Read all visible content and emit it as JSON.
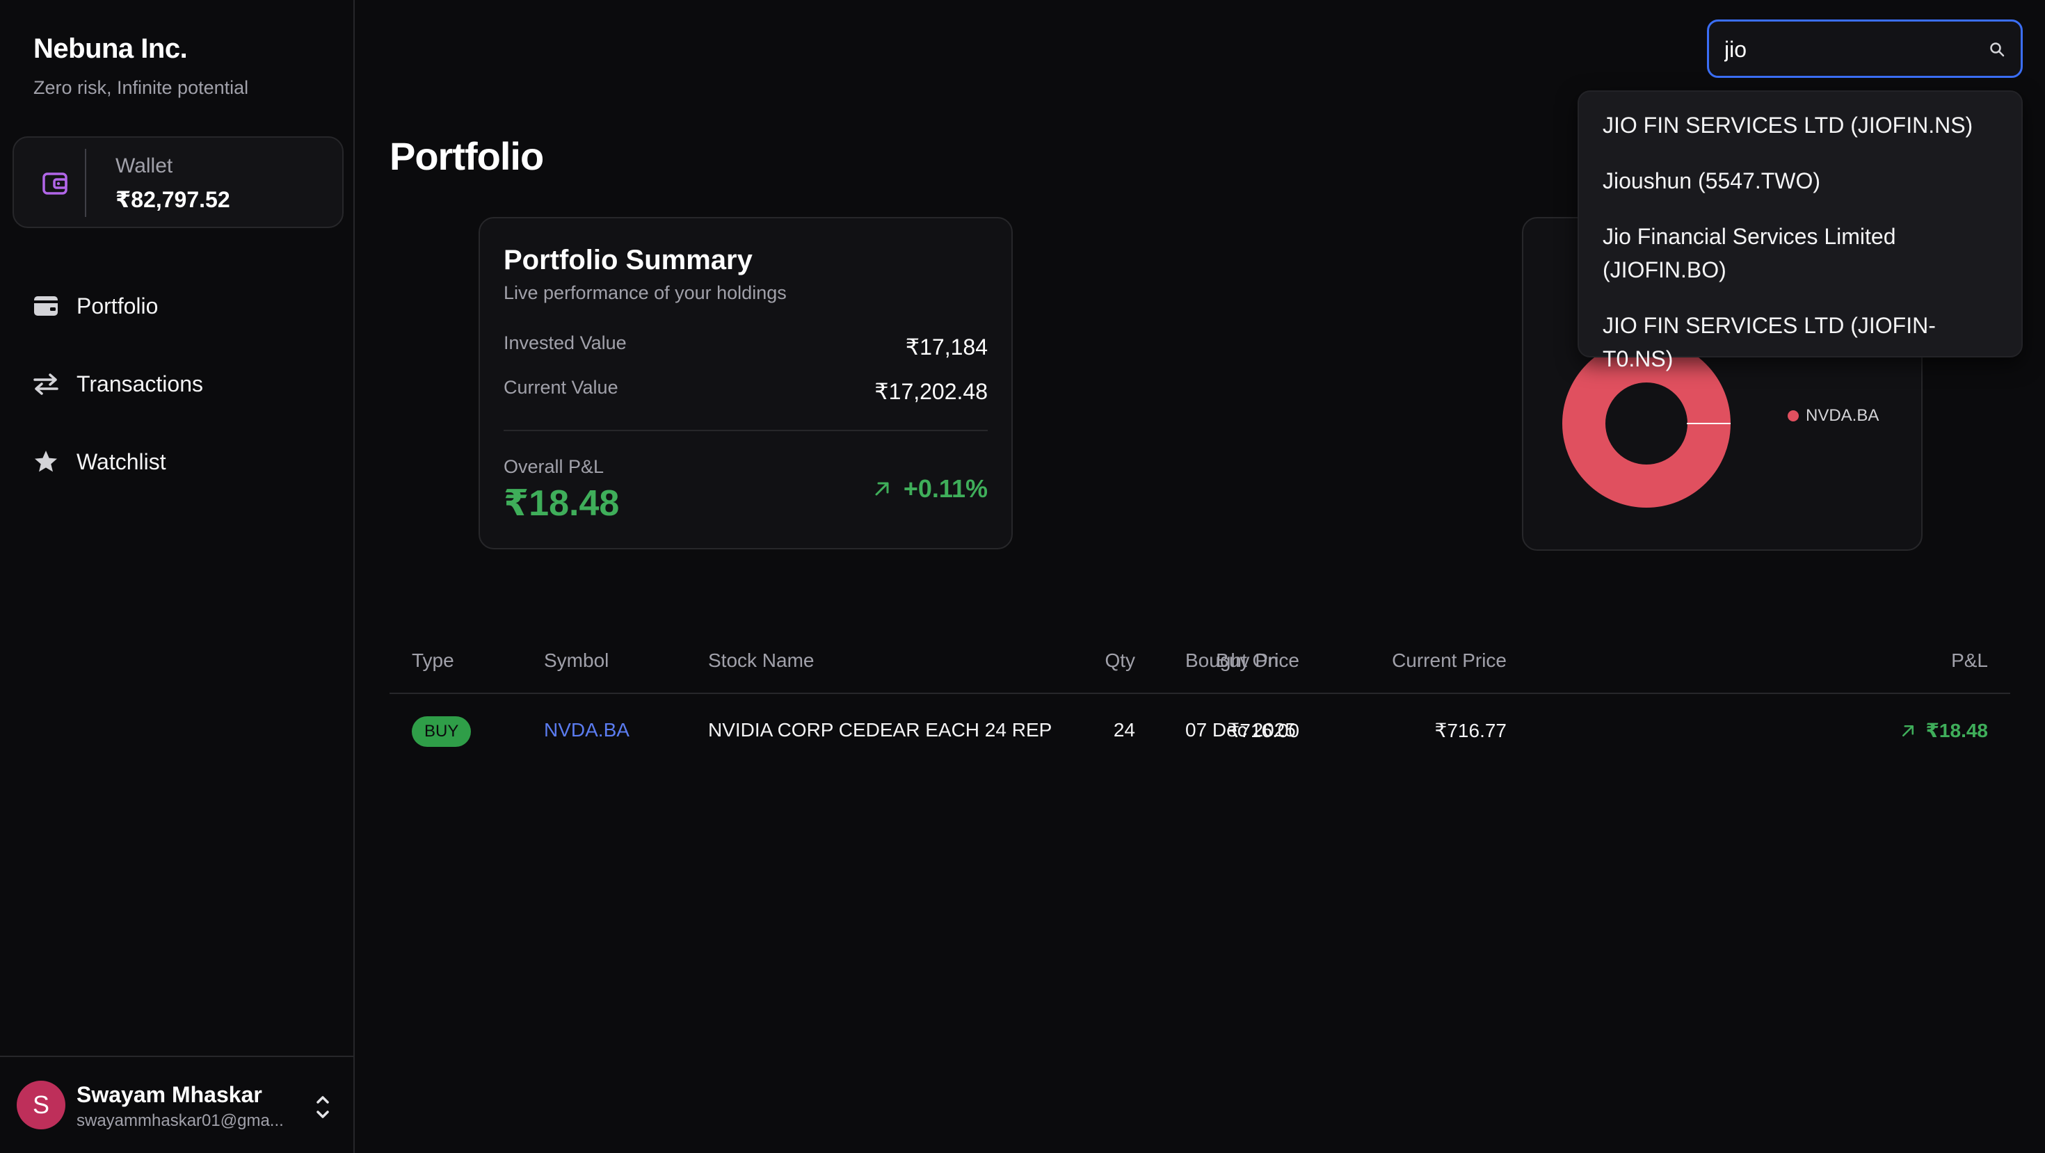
{
  "brand": {
    "title": "Nebuna Inc.",
    "subtitle": "Zero risk, Infinite potential"
  },
  "wallet": {
    "label": "Wallet",
    "value": "₹82,797.52",
    "icon": "wallet-icon",
    "icon_color": "#b166e8"
  },
  "nav": [
    {
      "label": "Portfolio",
      "icon": "card-icon"
    },
    {
      "label": "Transactions",
      "icon": "arrows-swap-icon"
    },
    {
      "label": "Watchlist",
      "icon": "star-icon"
    }
  ],
  "user": {
    "initial": "S",
    "name": "Swayam Mhaskar",
    "email": "swayammhaskar01@gma...",
    "avatar_color": "#be2f5a"
  },
  "page": {
    "title": "Portfolio"
  },
  "search": {
    "value": "jio",
    "results": [
      "JIO FIN SERVICES LTD (JIOFIN.NS)",
      "Jioushun (5547.TWO)",
      "Jio Financial Services Limited (JIOFIN.BO)",
      "JIO FIN SERVICES LTD (JIOFIN-T0.NS)"
    ]
  },
  "summary": {
    "title": "Portfolio Summary",
    "subtitle": "Live performance of your holdings",
    "invested_label": "Invested Value",
    "invested_value": "₹17,184",
    "current_label": "Current Value",
    "current_value": "₹17,202.48",
    "pnl_label": "Overall P&L",
    "pnl_value": "₹18.48",
    "pnl_pct": "+0.11%"
  },
  "allocation": {
    "legend": [
      {
        "name": "NVDA.BA",
        "color": "#e0505f"
      }
    ]
  },
  "chart_data": {
    "type": "pie",
    "categories": [
      "NVDA.BA"
    ],
    "values": [
      100
    ]
  },
  "table": {
    "headers": [
      "Type",
      "Symbol",
      "Stock Name",
      "Bought On",
      "Qty",
      "Buy Price",
      "Current Price",
      "P&L"
    ],
    "rows": [
      {
        "type": "BUY",
        "symbol": "NVDA.BA",
        "name": "NVIDIA CORP CEDEAR EACH 24 REP",
        "bought_on": "07 Dec 2025",
        "qty": "24",
        "buy_price": "₹716.00",
        "current_price": "₹716.77",
        "pl": "₹18.48"
      }
    ]
  },
  "colors": {
    "accent": "#3b6ef5",
    "positive": "#3fae5a",
    "buy_badge": "#2f9e48"
  }
}
